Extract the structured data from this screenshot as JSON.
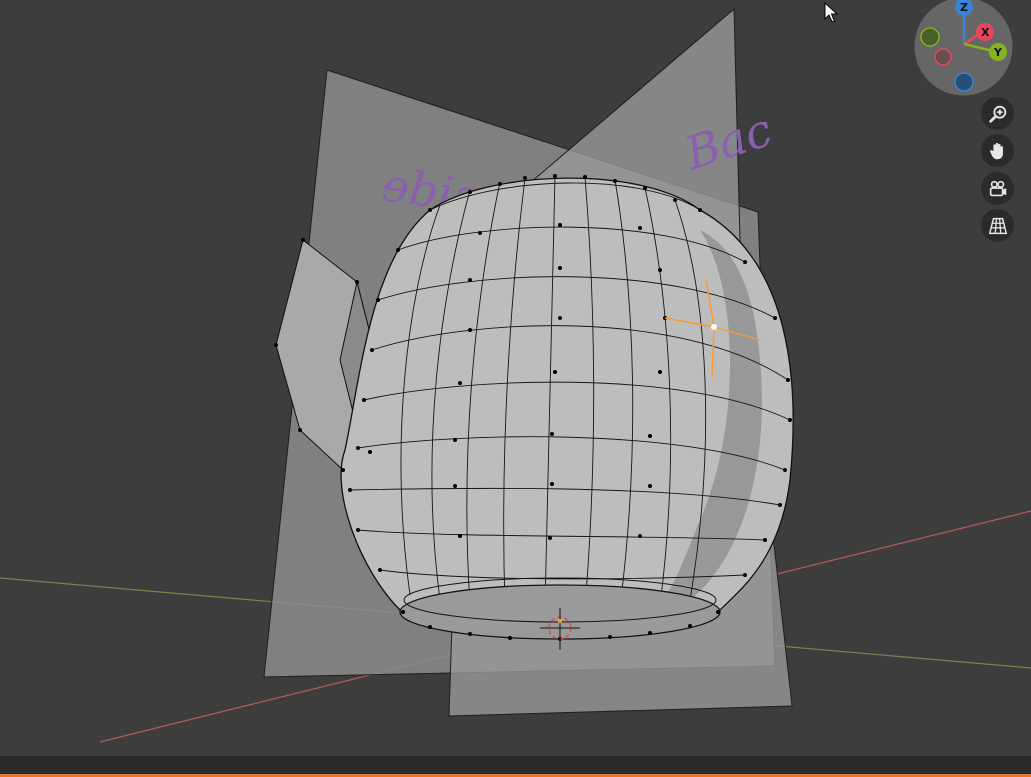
{
  "app": "Blender",
  "viewport": {
    "background_color": "#3d3d3d",
    "x_axis_color": "#b65a5a",
    "y_axis_color": "#6f8a4a",
    "mesh_color": "#b7b7b7",
    "selection_color": "#ff9a2e",
    "reference_image_text_left": "ɘbiƨ",
    "reference_image_text_right": "Bac"
  },
  "gizmo": {
    "z_label": "Z",
    "x_label": "X",
    "y_label": "Y",
    "z_color": "#3b83d8",
    "x_color": "#e9465b",
    "y_color": "#86b21f"
  },
  "nav_buttons": [
    {
      "icon": "zoom-icon",
      "tooltip": ""
    },
    {
      "icon": "hand-pan-icon",
      "tooltip": ""
    },
    {
      "icon": "camera-icon",
      "tooltip": ""
    },
    {
      "icon": "perspective-grid-icon",
      "tooltip": ""
    }
  ],
  "status_bar": {
    "accent_color": "#e8772e"
  }
}
